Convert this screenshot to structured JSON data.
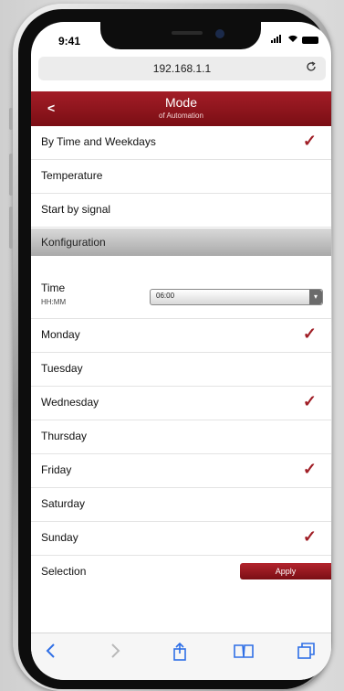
{
  "status": {
    "time": "9:41"
  },
  "browser": {
    "url": "192.168.1.1"
  },
  "header": {
    "title": "Mode",
    "subtitle": "of Automation",
    "back_label": "<"
  },
  "modes": [
    {
      "label": "By Time and Weekdays",
      "checked": true
    },
    {
      "label": "Temperature",
      "checked": false
    },
    {
      "label": "Start by signal",
      "checked": false
    }
  ],
  "config": {
    "section_title": "Konfiguration",
    "time_label": "Time",
    "time_format": "HH:MM",
    "time_value": "06:00",
    "days": [
      {
        "label": "Monday",
        "checked": true
      },
      {
        "label": "Tuesday",
        "checked": false
      },
      {
        "label": "Wednesday",
        "checked": true
      },
      {
        "label": "Thursday",
        "checked": false
      },
      {
        "label": "Friday",
        "checked": true
      },
      {
        "label": "Saturday",
        "checked": false
      },
      {
        "label": "Sunday",
        "checked": true
      }
    ],
    "selection_label": "Selection",
    "apply_label": "Apply"
  },
  "icons": {
    "check": "checkmark-icon",
    "back": "chevron-left-icon",
    "forward": "chevron-right-icon",
    "share": "share-icon",
    "bookmarks": "book-icon",
    "tabs": "tabs-icon",
    "reload": "reload-icon"
  },
  "colors": {
    "accent": "#a01e26",
    "ios_blue": "#2f6fe6"
  }
}
